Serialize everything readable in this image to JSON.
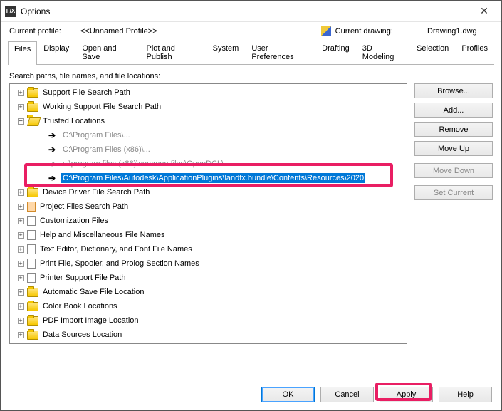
{
  "window": {
    "title": "Options",
    "app_icon_text": "F/X"
  },
  "profile": {
    "label": "Current profile:",
    "value": "<<Unnamed Profile>>",
    "drawing_label": "Current drawing:",
    "drawing_value": "Drawing1.dwg"
  },
  "tabs": [
    "Files",
    "Display",
    "Open and Save",
    "Plot and Publish",
    "System",
    "User Preferences",
    "Drafting",
    "3D Modeling",
    "Selection",
    "Profiles"
  ],
  "active_tab_index": 0,
  "section_label": "Search paths, file names, and file locations:",
  "tree": [
    {
      "level": 0,
      "exp": "plus",
      "icon": "folder",
      "text": "Support File Search Path"
    },
    {
      "level": 0,
      "exp": "plus",
      "icon": "folder",
      "text": "Working Support File Search Path"
    },
    {
      "level": 0,
      "exp": "minus",
      "icon": "folder-open",
      "text": "Trusted Locations"
    },
    {
      "level": 1,
      "exp": "none",
      "icon": "arrow",
      "text": "C:\\Program Files\\...",
      "grey": true
    },
    {
      "level": 1,
      "exp": "none",
      "icon": "arrow",
      "text": "C:\\Program Files (x86)\\...",
      "grey": true
    },
    {
      "level": 1,
      "exp": "none",
      "icon": "arrow-grey",
      "text": "c:\\program files (x86)\\common files\\OpenDCL\\",
      "grey": true
    },
    {
      "level": 1,
      "exp": "none",
      "icon": "arrow",
      "text": "C:\\Program Files\\Autodesk\\ApplicationPlugins\\landfx.bundle\\Contents\\Resources\\2020",
      "selected": true,
      "highlighted": true
    },
    {
      "level": 0,
      "exp": "plus",
      "icon": "folder",
      "text": "Device Driver File Search Path"
    },
    {
      "level": 0,
      "exp": "plus",
      "icon": "file-orange",
      "text": "Project Files Search Path"
    },
    {
      "level": 0,
      "exp": "plus",
      "icon": "file",
      "text": "Customization Files"
    },
    {
      "level": 0,
      "exp": "plus",
      "icon": "file",
      "text": "Help and Miscellaneous File Names"
    },
    {
      "level": 0,
      "exp": "plus",
      "icon": "file",
      "text": "Text Editor, Dictionary, and Font File Names"
    },
    {
      "level": 0,
      "exp": "plus",
      "icon": "file",
      "text": "Print File, Spooler, and Prolog Section Names"
    },
    {
      "level": 0,
      "exp": "plus",
      "icon": "file",
      "text": "Printer Support File Path"
    },
    {
      "level": 0,
      "exp": "plus",
      "icon": "folder",
      "text": "Automatic Save File Location"
    },
    {
      "level": 0,
      "exp": "plus",
      "icon": "folder",
      "text": "Color Book Locations"
    },
    {
      "level": 0,
      "exp": "plus",
      "icon": "folder",
      "text": "PDF Import Image Location"
    },
    {
      "level": 0,
      "exp": "plus",
      "icon": "folder",
      "text": "Data Sources Location"
    }
  ],
  "side_buttons": [
    {
      "label": "Browse...",
      "enabled": true
    },
    {
      "label": "Add...",
      "enabled": true
    },
    {
      "label": "Remove",
      "enabled": true
    },
    {
      "label": "Move Up",
      "enabled": true
    },
    {
      "label": "Move Down",
      "enabled": false
    },
    {
      "label": "Set Current",
      "enabled": false
    }
  ],
  "footer_buttons": [
    {
      "label": "OK",
      "default": true
    },
    {
      "label": "Cancel",
      "default": false
    },
    {
      "label": "Apply",
      "default": false,
      "highlighted": true
    },
    {
      "label": "Help",
      "default": false
    }
  ]
}
